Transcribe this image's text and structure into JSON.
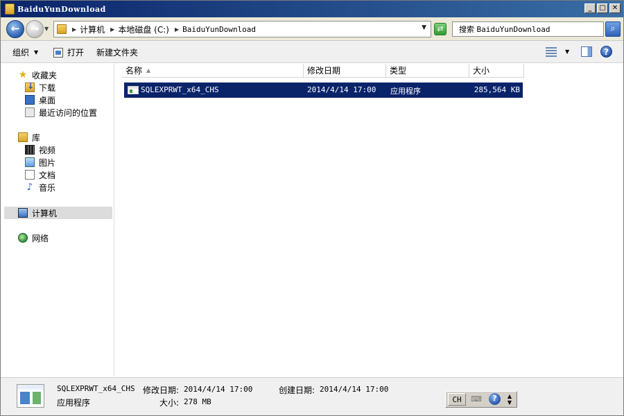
{
  "window": {
    "title": "BaiduYunDownload",
    "buttons": {
      "minimize": "_",
      "maximize": "□",
      "close": "✕"
    }
  },
  "address": {
    "crumbs": [
      "计算机",
      "本地磁盘 (C:)",
      "BaiduYunDownload"
    ]
  },
  "search": {
    "prefix": "搜索",
    "scope": "BaiduYunDownload"
  },
  "toolbar": {
    "organize": "组织",
    "open": "打开",
    "new_folder": "新建文件夹"
  },
  "nav": {
    "favorites": "收藏夹",
    "downloads": "下载",
    "desktop": "桌面",
    "recent": "最近访问的位置",
    "libraries": "库",
    "videos": "视频",
    "pictures": "图片",
    "documents": "文档",
    "music": "音乐",
    "computer": "计算机",
    "network": "网络"
  },
  "columns": {
    "name": "名称",
    "modified": "修改日期",
    "type": "类型",
    "size": "大小"
  },
  "files": [
    {
      "name": "SQLEXPRWT_x64_CHS",
      "modified": "2014/4/14 17:00",
      "type": "应用程序",
      "size": "285,564 KB"
    }
  ],
  "details": {
    "name": "SQLEXPRWT_x64_CHS",
    "type": "应用程序",
    "modified_label": "修改日期:",
    "modified": "2014/4/14 17:00",
    "created_label": "创建日期:",
    "created": "2014/4/14 17:00",
    "size_label": "大小:",
    "size": "278 MB"
  },
  "langbar": {
    "lang": "CH",
    "help": "?"
  },
  "colors": {
    "title_bar": "#0a246a",
    "selection": "#0a246a",
    "selection_text": "#ffffff"
  }
}
